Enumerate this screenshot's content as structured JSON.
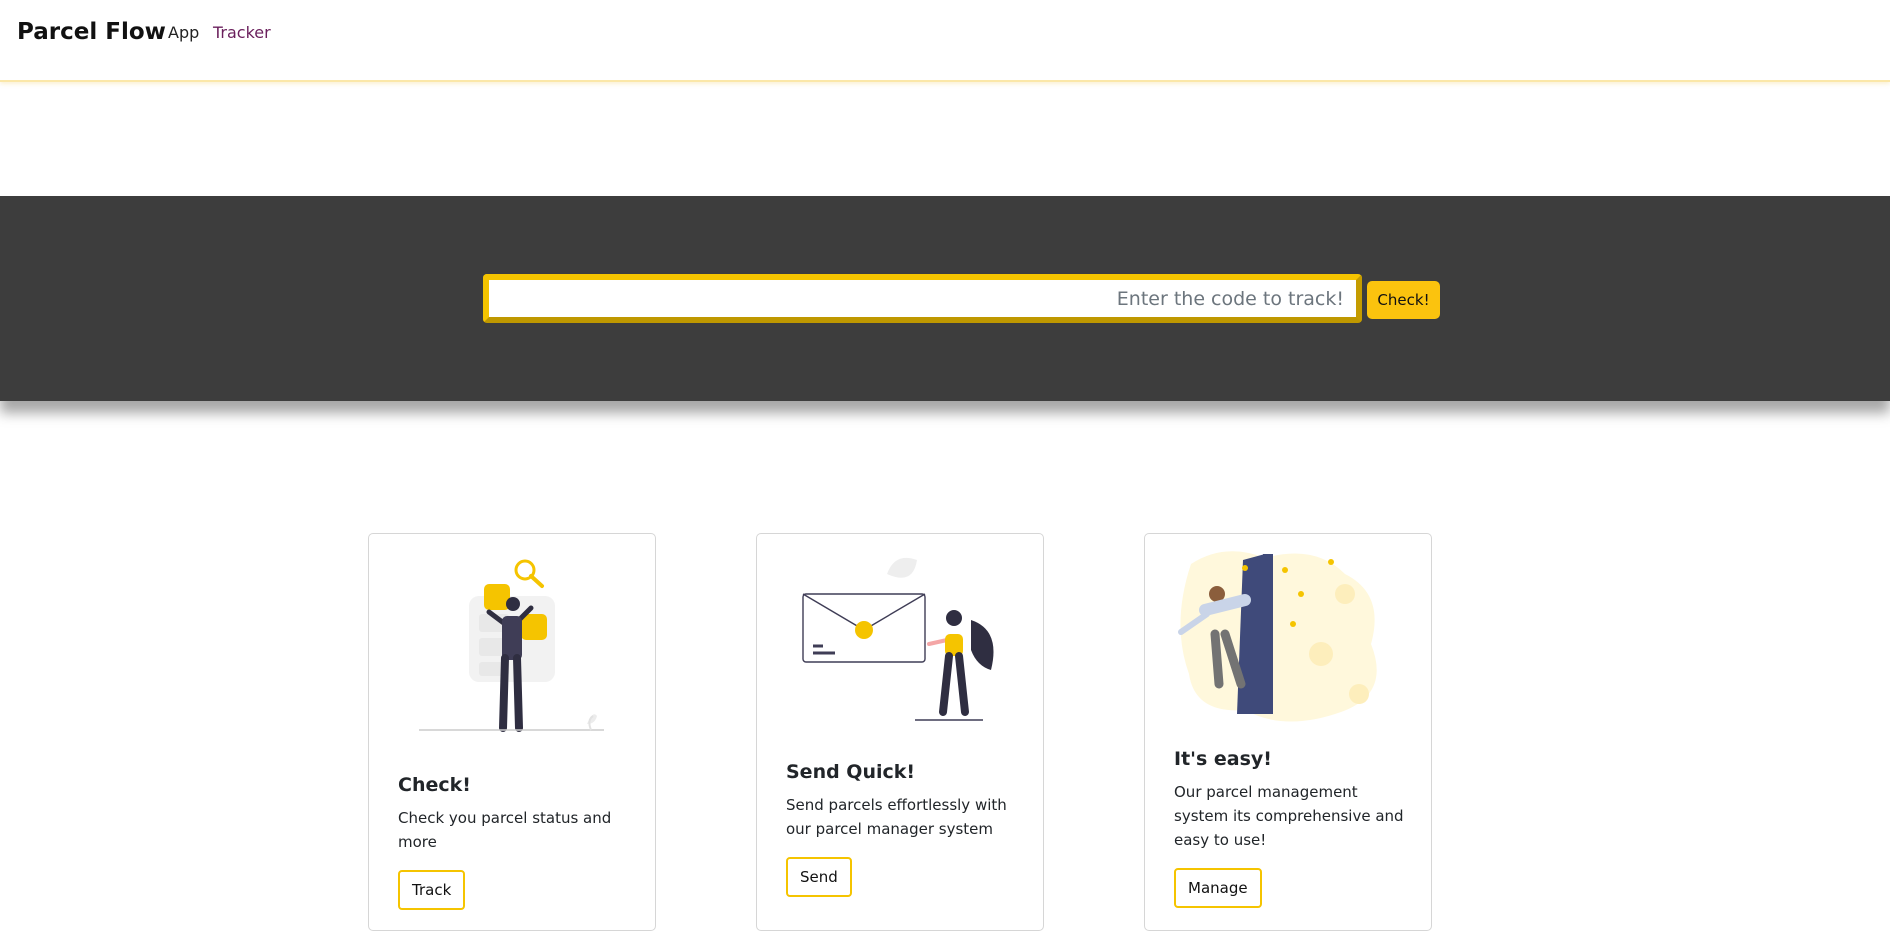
{
  "navbar": {
    "brand": "Parcel Flow",
    "links": [
      "App",
      "Tracker"
    ]
  },
  "hero": {
    "search_placeholder": "Enter the code to track!",
    "check_label": "Check!",
    "accent_color": "#fbc30e"
  },
  "cards": [
    {
      "title": "Check!",
      "text": "Check you parcel status and more",
      "button": "Track",
      "illustration": "person-searching-illustration"
    },
    {
      "title": "Send Quick!",
      "text": "Send parcels effortlessly with our parcel manager system",
      "button": "Send",
      "illustration": "envelope-person-illustration"
    },
    {
      "title": "It's easy!",
      "text": "Our parcel management system its comprehensive and easy to use!",
      "button": "Manage",
      "illustration": "person-lamppost-illustration"
    }
  ]
}
